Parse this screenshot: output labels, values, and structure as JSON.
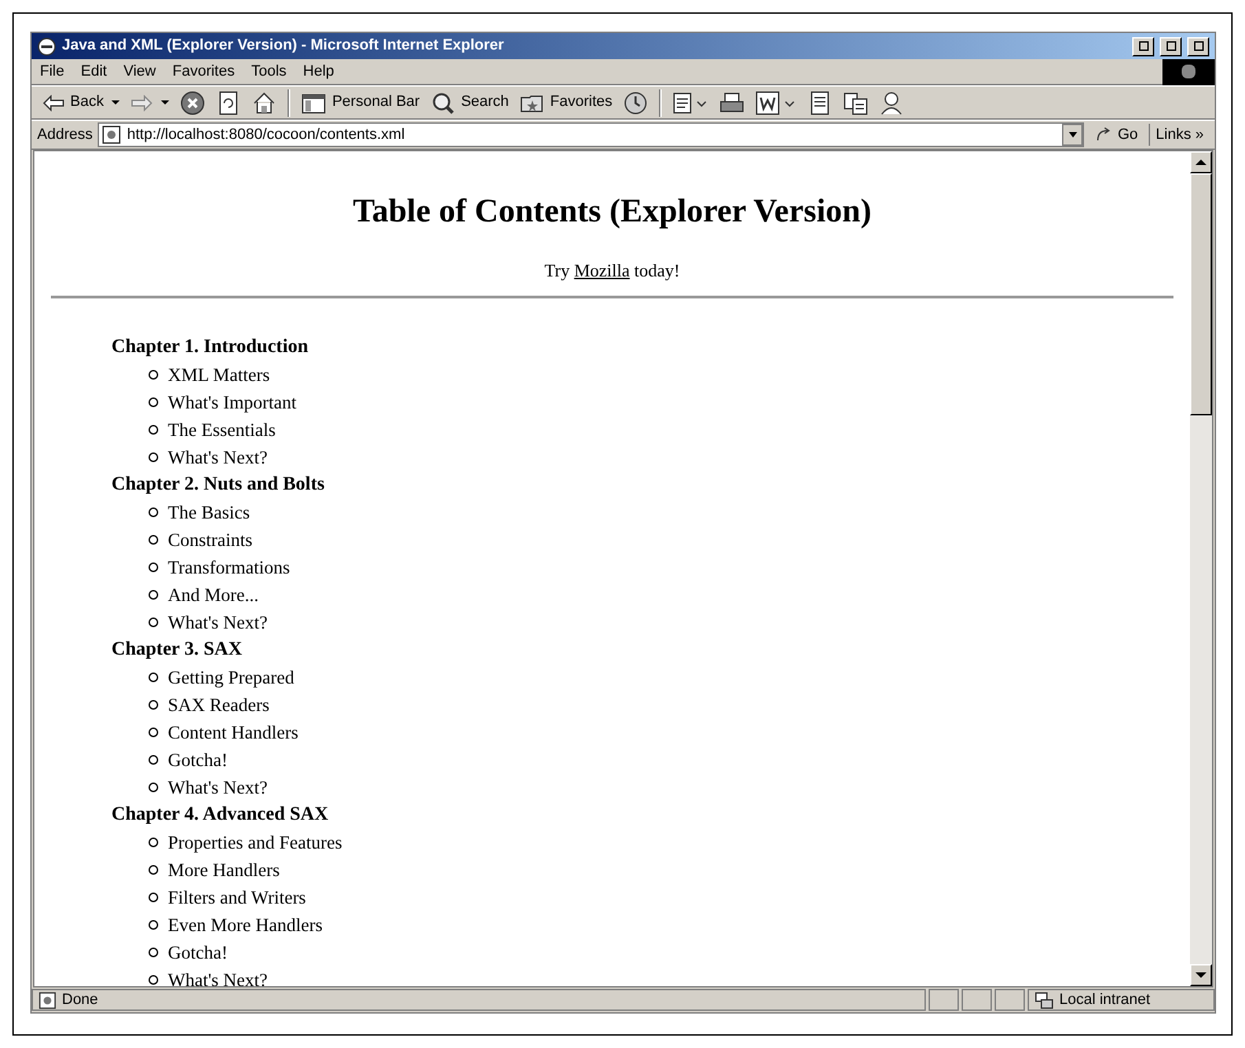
{
  "window": {
    "title": "Java and XML (Explorer Version) - Microsoft Internet Explorer"
  },
  "menu": [
    "File",
    "Edit",
    "View",
    "Favorites",
    "Tools",
    "Help"
  ],
  "toolbar": [
    {
      "kind": "back",
      "label": "Back"
    },
    {
      "kind": "forward"
    },
    {
      "kind": "stop"
    },
    {
      "kind": "refresh"
    },
    {
      "kind": "home"
    },
    {
      "kind": "separator"
    },
    {
      "kind": "personal",
      "label": "Personal Bar"
    },
    {
      "kind": "search",
      "label": "Search"
    },
    {
      "kind": "favorites",
      "label": "Favorites"
    },
    {
      "kind": "history"
    },
    {
      "kind": "separator"
    },
    {
      "kind": "mail"
    },
    {
      "kind": "print"
    },
    {
      "kind": "edit"
    },
    {
      "kind": "discuss"
    },
    {
      "kind": "messenger"
    },
    {
      "kind": "people"
    }
  ],
  "address": {
    "label": "Address",
    "value": "http://localhost:8080/cocoon/contents.xml",
    "go": "Go",
    "links": "Links »"
  },
  "page": {
    "heading": "Table of Contents (Explorer Version)",
    "promo": {
      "before": "Try",
      "link": "Mozilla",
      "after": "today!"
    },
    "chapters": [
      {
        "title": "Chapter 1. Introduction",
        "children": [
          "XML Matters",
          "What's Important",
          "The Essentials",
          "What's Next?"
        ]
      },
      {
        "title": "Chapter 2. Nuts and Bolts",
        "children": [
          "The Basics",
          "Constraints",
          "Transformations",
          "And More...",
          "What's Next?"
        ]
      },
      {
        "title": "Chapter 3. SAX",
        "children": [
          "Getting Prepared",
          "SAX Readers",
          "Content Handlers",
          "Gotcha!",
          "What's Next?"
        ]
      },
      {
        "title": "Chapter 4. Advanced SAX",
        "children": [
          "Properties and Features",
          "More Handlers",
          "Filters and Writers",
          "Even More Handlers",
          "Gotcha!",
          "What's Next?"
        ]
      }
    ]
  },
  "status_bar": {
    "text": "Done",
    "zone": "Local intranet"
  }
}
